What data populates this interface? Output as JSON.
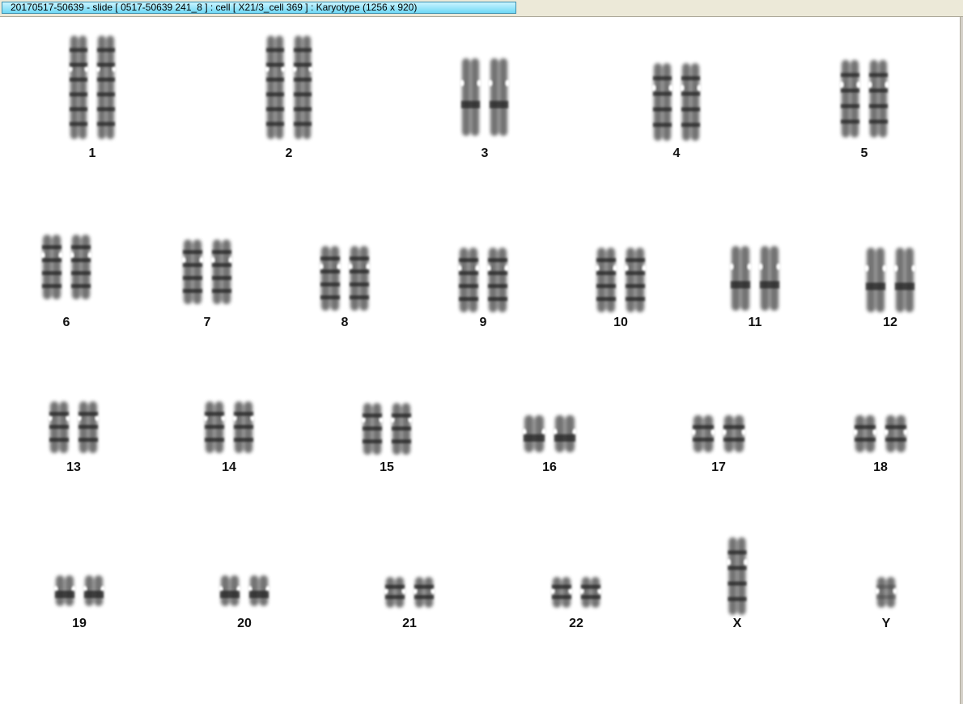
{
  "window": {
    "title": "20170517-50639 - slide [ 0517-50639 241_8 ] : cell [ X21/3_cell 369 ] : Karyotype  (1256 x 920)"
  },
  "karyotype": {
    "groups": [
      {
        "label": "1",
        "count": 2,
        "size": "xl",
        "marks": "banded",
        "row": 1
      },
      {
        "label": "2",
        "count": 2,
        "size": "xl",
        "marks": "banded",
        "row": 1
      },
      {
        "label": "3",
        "count": 2,
        "size": "l",
        "marks": "dark-center",
        "row": 1
      },
      {
        "label": "4",
        "count": 2,
        "size": "l",
        "marks": "banded",
        "row": 1
      },
      {
        "label": "5",
        "count": 2,
        "size": "l",
        "marks": "banded",
        "row": 1
      },
      {
        "label": "6",
        "count": 2,
        "size": "m",
        "marks": "banded",
        "row": 2
      },
      {
        "label": "7",
        "count": 2,
        "size": "m",
        "marks": "banded",
        "row": 2
      },
      {
        "label": "8",
        "count": 2,
        "size": "m",
        "marks": "banded",
        "row": 2
      },
      {
        "label": "9",
        "count": 2,
        "size": "m",
        "marks": "banded",
        "row": 2
      },
      {
        "label": "10",
        "count": 2,
        "size": "m",
        "marks": "banded",
        "row": 2
      },
      {
        "label": "11",
        "count": 2,
        "size": "m",
        "marks": "dark-center",
        "row": 2
      },
      {
        "label": "12",
        "count": 2,
        "size": "m",
        "marks": "dark-center",
        "row": 2
      },
      {
        "label": "13",
        "count": 2,
        "size": "s",
        "marks": "banded",
        "row": 3
      },
      {
        "label": "14",
        "count": 2,
        "size": "s",
        "marks": "banded",
        "row": 3
      },
      {
        "label": "15",
        "count": 2,
        "size": "s",
        "marks": "banded",
        "row": 3
      },
      {
        "label": "16",
        "count": 2,
        "size": "xs",
        "marks": "dark-center",
        "row": 3
      },
      {
        "label": "17",
        "count": 2,
        "size": "xs",
        "marks": "banded",
        "row": 3
      },
      {
        "label": "18",
        "count": 2,
        "size": "xs",
        "marks": "banded",
        "row": 3
      },
      {
        "label": "19",
        "count": 2,
        "size": "xxs",
        "marks": "dark-center",
        "row": 4
      },
      {
        "label": "20",
        "count": 2,
        "size": "xxs",
        "marks": "dark-center",
        "row": 4
      },
      {
        "label": "21",
        "count": 2,
        "size": "xxs",
        "marks": "banded",
        "row": 4
      },
      {
        "label": "22",
        "count": 2,
        "size": "xxs",
        "marks": "banded",
        "row": 4
      },
      {
        "label": "X",
        "count": 1,
        "size": "l",
        "marks": "banded",
        "row": 4
      },
      {
        "label": "Y",
        "count": 1,
        "size": "xxs",
        "marks": "light",
        "row": 4
      }
    ]
  },
  "colors": {
    "chromosome": "#5a5a5a",
    "band": "#222222",
    "label": "#111111",
    "tab": "#6fd8f5"
  }
}
